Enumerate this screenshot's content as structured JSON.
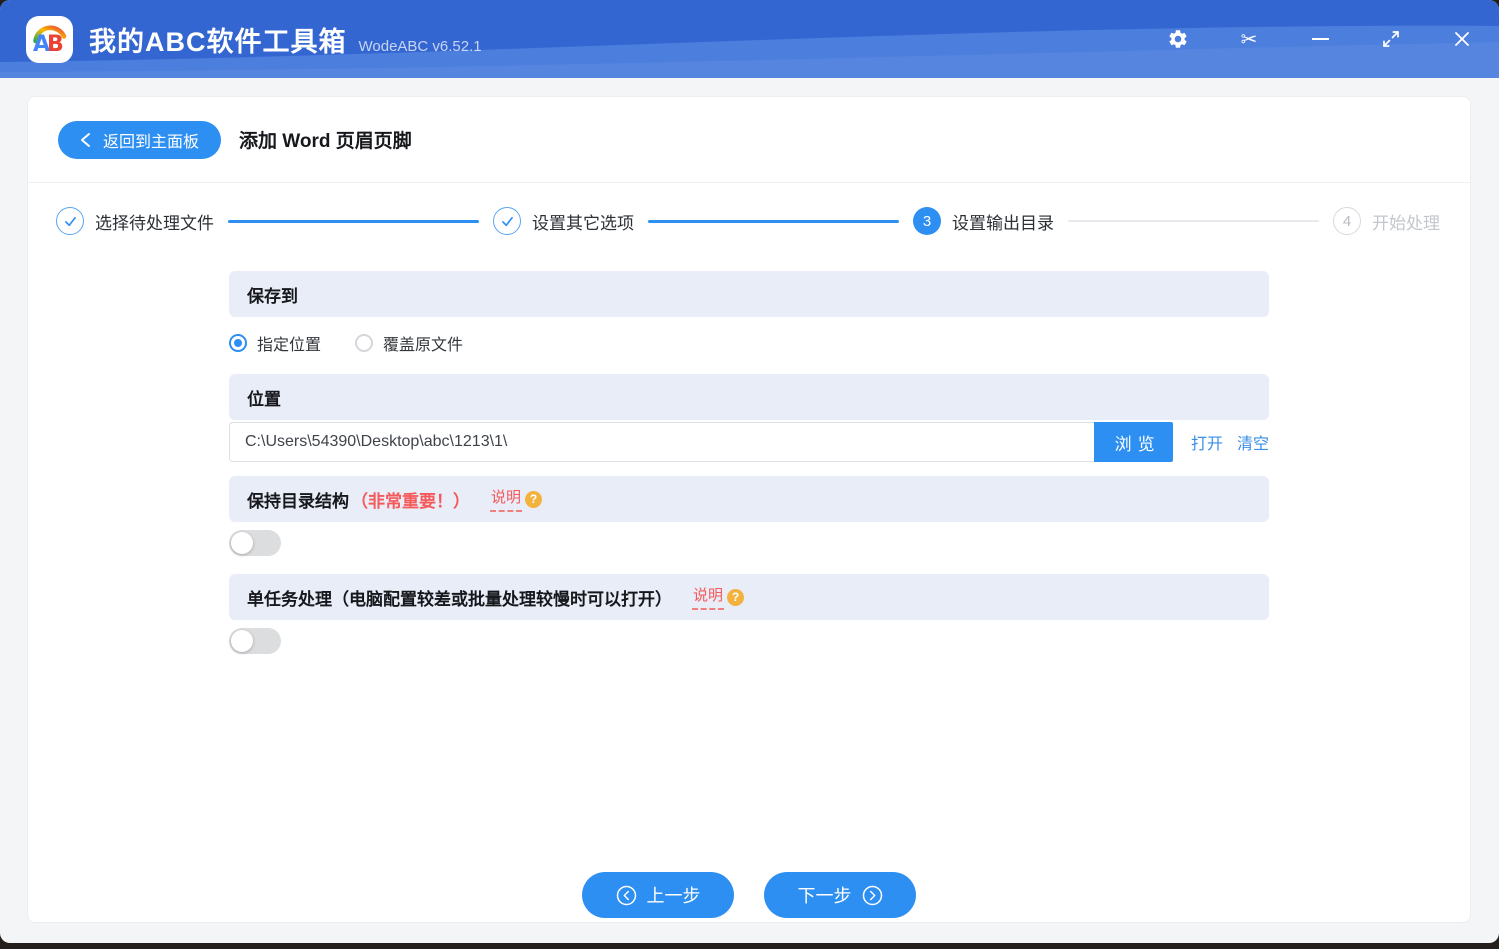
{
  "titlebar": {
    "logo": "AB",
    "app_title": "我的ABC软件工具箱",
    "version": "WodeABC v6.52.1"
  },
  "header": {
    "back_label": "返回到主面板",
    "page_title": "添加 Word 页眉页脚"
  },
  "stepper": {
    "steps": [
      {
        "label": "选择待处理文件",
        "state": "done"
      },
      {
        "label": "设置其它选项",
        "state": "done"
      },
      {
        "label": "设置输出目录",
        "state": "active",
        "number": "3"
      },
      {
        "label": "开始处理",
        "state": "pending",
        "number": "4"
      }
    ]
  },
  "form": {
    "save_to": {
      "title": "保存到",
      "radio_specified": "指定位置",
      "radio_overwrite": "覆盖原文件",
      "selected": "指定位置"
    },
    "location": {
      "title": "位置",
      "path": "C:\\Users\\54390\\Desktop\\abc\\1213\\1\\",
      "browse_label": "浏览",
      "open_label": "打开",
      "clear_label": "清空"
    },
    "keep_structure": {
      "title": "保持目录结构",
      "important_note": "（非常重要！）",
      "help_label": "说明",
      "help_mark": "?",
      "enabled": false
    },
    "single_task": {
      "title": "单任务处理（电脑配置较差或批量处理较慢时可以打开）",
      "help_label": "说明",
      "help_mark": "?",
      "enabled": false
    }
  },
  "footer": {
    "prev_label": "上一步",
    "next_label": "下一步"
  },
  "colors": {
    "accent": "#2e8ff2",
    "titlebar_base": "#3366d1",
    "titlebar_wave": "#4c7ede",
    "section_bg": "#e9edf8",
    "alert_red": "#f5595a",
    "help_gold": "#f3b23e"
  }
}
